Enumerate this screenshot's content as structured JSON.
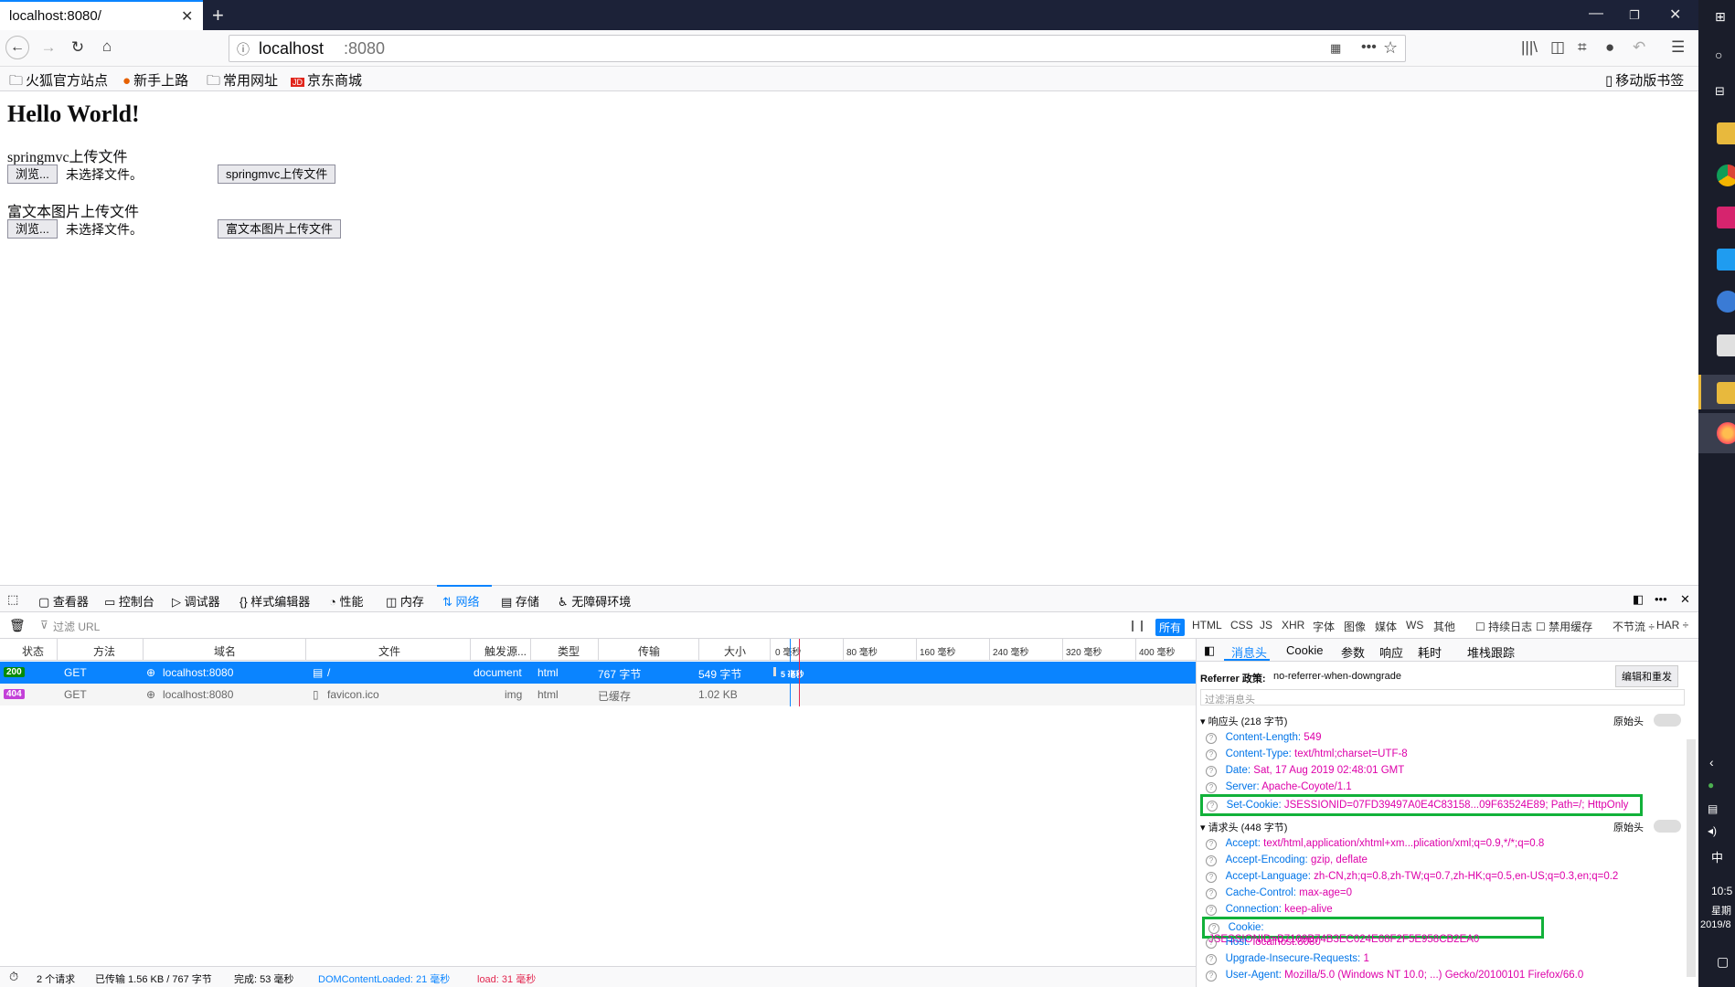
{
  "browser": {
    "tab_title": "localhost:8080/",
    "url_host": "localhost",
    "url_port": ":8080",
    "bookmarks": [
      "火狐官方站点",
      "新手上路",
      "常用网址",
      "京东商城"
    ],
    "mobile_bookmarks": "移动版书签"
  },
  "page": {
    "heading": "Hello World!",
    "section1_title": "springmvc上传文件",
    "section2_title": "富文本图片上传文件",
    "browse_label": "浏览...",
    "no_file": "未选择文件。",
    "upload1_label": "springmvc上传文件",
    "upload2_label": "富文本图片上传文件"
  },
  "devtools": {
    "tabs": [
      "查看器",
      "控制台",
      "调试器",
      "样式编辑器",
      "性能",
      "内存",
      "网络",
      "存储",
      "无障碍环境"
    ],
    "selected_tab": "网络",
    "filter_placeholder": "过滤 URL",
    "filter_types": [
      "所有",
      "HTML",
      "CSS",
      "JS",
      "XHR",
      "字体",
      "图像",
      "媒体",
      "WS",
      "其他"
    ],
    "persist_log": "持续日志",
    "disable_cache": "禁用缓存",
    "throttle": "不节流 ÷",
    "har": "HAR ÷",
    "columns": [
      "状态",
      "方法",
      "域名",
      "文件",
      "触发源...",
      "类型",
      "传输",
      "大小"
    ],
    "timeline_ticks": [
      "0 毫秒",
      "80 毫秒",
      "160 毫秒",
      "240 毫秒",
      "320 毫秒",
      "400 毫秒"
    ],
    "requests": [
      {
        "status": "200",
        "method": "GET",
        "domain": "localhost:8080",
        "file": "/",
        "cause": "document",
        "type": "html",
        "transferred": "767 字节",
        "size": "549 字节",
        "timing": "5 毫秒"
      },
      {
        "status": "404",
        "method": "GET",
        "domain": "localhost:8080",
        "file": "favicon.ico",
        "cause": "img",
        "type": "html",
        "transferred": "已缓存",
        "size": "1.02 KB",
        "timing": ""
      }
    ],
    "panel_tabs": [
      "消息头",
      "Cookie",
      "参数",
      "响应",
      "耗时",
      "堆栈跟踪"
    ],
    "referrer_label": "Referrer 政策:",
    "referrer_value": "no-referrer-when-downgrade",
    "edit_resend": "编辑和重发",
    "filter_headers_placeholder": "过滤消息头",
    "response_section": "响应头 (218 字节)",
    "request_section": "请求头 (448 字节)",
    "raw_headers": "原始头",
    "response_headers": [
      {
        "k": "Content-Length:",
        "v": "549"
      },
      {
        "k": "Content-Type:",
        "v": "text/html;charset=UTF-8"
      },
      {
        "k": "Date:",
        "v": "Sat, 17 Aug 2019 02:48:01 GMT"
      },
      {
        "k": "Server:",
        "v": "Apache-Coyote/1.1"
      },
      {
        "k": "Set-Cookie:",
        "v": "JSESSIONID=07FD39497A0E4C83158...09F63524E89; Path=/; HttpOnly"
      }
    ],
    "request_headers": [
      {
        "k": "Accept:",
        "v": "text/html,application/xhtml+xm...plication/xml;q=0.9,*/*;q=0.8"
      },
      {
        "k": "Accept-Encoding:",
        "v": "gzip, deflate"
      },
      {
        "k": "Accept-Language:",
        "v": "zh-CN,zh;q=0.8,zh-TW;q=0.7,zh-HK;q=0.5,en-US;q=0.3,en;q=0.2"
      },
      {
        "k": "Cache-Control:",
        "v": "max-age=0"
      },
      {
        "k": "Connection:",
        "v": "keep-alive"
      },
      {
        "k": "Cookie:",
        "v": "JSESSIONID=B7109B74B3EC024E68F2F5E958CB2EA0"
      },
      {
        "k": "Host:",
        "v": "localhost:8080"
      },
      {
        "k": "Upgrade-Insecure-Requests:",
        "v": "1"
      },
      {
        "k": "User-Agent:",
        "v": "Mozilla/5.0 (Windows NT 10.0; ...) Gecko/20100101 Firefox/66.0"
      }
    ],
    "status_requests": "2 个请求",
    "status_transferred": "已传输 1.56 KB / 767 字节",
    "status_finish": "完成: 53 毫秒",
    "status_dom": "DOMContentLoaded: 21 毫秒",
    "status_load": "load: 31 毫秒"
  },
  "taskbar": {
    "time": "10:5",
    "weekday": "星期",
    "date": "2019/8",
    "ime": "中"
  }
}
